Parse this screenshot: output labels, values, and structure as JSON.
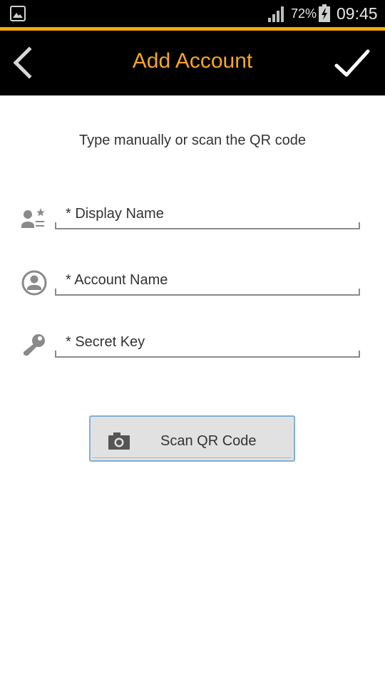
{
  "status_bar": {
    "battery_percent": "72%",
    "time": "09:45",
    "icons": [
      "gallery-icon",
      "signal-icon",
      "battery-charging-icon"
    ]
  },
  "app_bar": {
    "title": "Add Account",
    "back_icon": "chevron-left-icon",
    "confirm_icon": "checkmark-icon"
  },
  "form": {
    "instructions": "Type manually or scan the QR code",
    "fields": [
      {
        "icon": "user-star-icon",
        "placeholder": "* Display Name",
        "value": ""
      },
      {
        "icon": "account-circle-icon",
        "placeholder": "* Account Name",
        "value": ""
      },
      {
        "icon": "key-icon",
        "placeholder": "* Secret Key",
        "value": ""
      }
    ],
    "scan_button": {
      "icon": "camera-icon",
      "label": "Scan QR Code"
    }
  },
  "colors": {
    "accent": "#f5a623",
    "app_bar_bg": "#000000",
    "status_accent_line": "#f5a800",
    "scan_button_border": "#7fb0d6"
  }
}
